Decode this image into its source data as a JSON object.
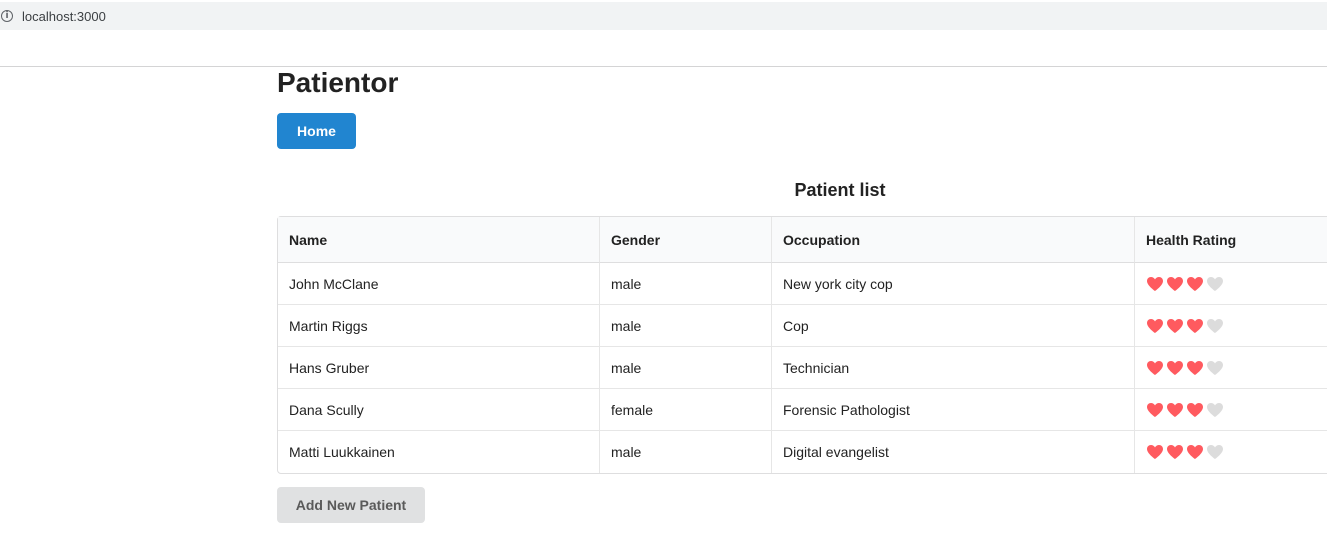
{
  "browser": {
    "url": "localhost:3000",
    "info_icon": "info-icon"
  },
  "app": {
    "title": "Patientor",
    "home_label": "Home"
  },
  "patient_list": {
    "title": "Patient list",
    "columns": [
      "Name",
      "Gender",
      "Occupation",
      "Health Rating"
    ],
    "rows": [
      {
        "name": "John McClane",
        "gender": "male",
        "occupation": "New york city cop",
        "health_rating": 3,
        "max_rating": 4
      },
      {
        "name": "Martin Riggs",
        "gender": "male",
        "occupation": "Cop",
        "health_rating": 3,
        "max_rating": 4
      },
      {
        "name": "Hans Gruber",
        "gender": "male",
        "occupation": "Technician",
        "health_rating": 3,
        "max_rating": 4
      },
      {
        "name": "Dana Scully",
        "gender": "female",
        "occupation": "Forensic Pathologist",
        "health_rating": 3,
        "max_rating": 4
      },
      {
        "name": "Matti Luukkainen",
        "gender": "male",
        "occupation": "Digital evangelist",
        "health_rating": 3,
        "max_rating": 4
      }
    ],
    "add_label": "Add New Patient"
  },
  "colors": {
    "primary": "#2185d0",
    "heart_filled": "#ff5a5f",
    "heart_empty": "#dcdcdc",
    "secondary_button": "#e0e1e2"
  }
}
